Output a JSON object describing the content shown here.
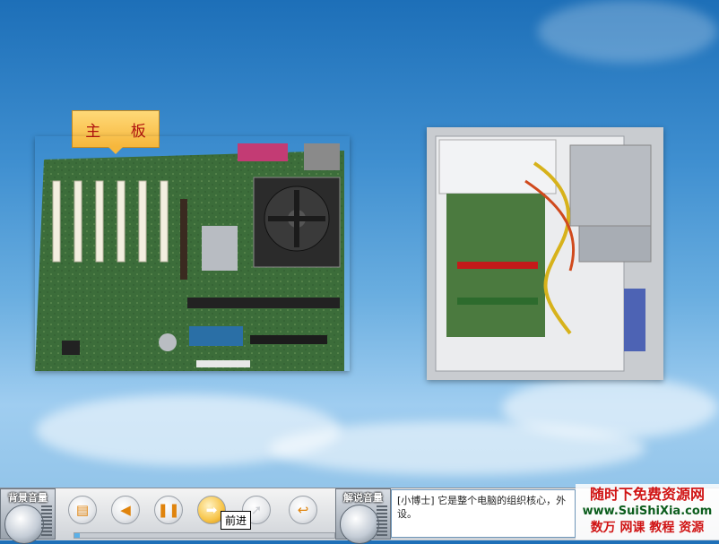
{
  "slide": {
    "title_tag": "主 板"
  },
  "images": {
    "motherboard": "motherboard-photo",
    "pc_case": "open-pc-case-photo"
  },
  "controls": {
    "background_volume_label": "背景音量",
    "narration_volume_label": "解说音量",
    "tooltip": "前进",
    "progress": 0.02,
    "buttons": [
      "book-icon",
      "prev-icon",
      "pause-icon",
      "forward-icon",
      "pointer-icon",
      "back-icon"
    ]
  },
  "narration": {
    "text": "[小博士] 它是整个电脑的组织核心，外设。"
  },
  "watermark": {
    "line1": "随时下免费资源网",
    "line2": "www.SuiShiXia.com",
    "line3": "数万 网课 教程 资源"
  },
  "colors": {
    "title_bg": "#f6b73c",
    "title_text": "#b0120e",
    "accent": "#e0840d"
  }
}
